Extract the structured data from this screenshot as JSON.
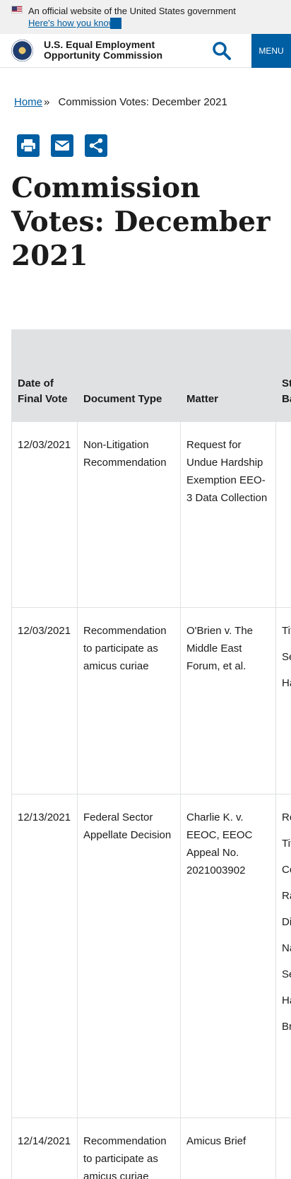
{
  "gov_banner": {
    "text": "An official website of the United States government",
    "link": "Here's how you know"
  },
  "header": {
    "site_name_line1": "U.S. Equal Employment",
    "site_name_line2": "Opportunity Commission",
    "menu_label": "MENU"
  },
  "breadcrumb": {
    "home": "Home",
    "separator": "»",
    "current": "Commission Votes: December 2021"
  },
  "page": {
    "title": "Commission Votes: December 2021"
  },
  "table": {
    "headers": [
      "Date of Final Vote",
      "Document Type",
      "Matter",
      "Statutes/ Issues/ Bases Involved"
    ],
    "rows": [
      {
        "date": "12/03/2021",
        "type": "Non-Litigation Recommendation",
        "matter": "Request for Undue Hardship Exemption EEO-3 Data Collection",
        "issues": []
      },
      {
        "date": "12/03/2021",
        "type": "Recommendation to participate as amicus curiae",
        "matter": "O'Brien v. The Middle East Forum, et al.",
        "issues": [
          "Title VII",
          "Sex",
          "Harassment"
        ]
      },
      {
        "date": "12/13/2021",
        "type": "Federal Sector Appellate Decision",
        "matter": "Charlie K. v. EEOC, EEOC Appeal No. 2021003902",
        "issues": [
          "Rehabilitation Act",
          "Title VII",
          "Color",
          "Race",
          "Disability",
          "National Origin",
          "Sex",
          "Harassment",
          "Breach of Confidentiality"
        ]
      },
      {
        "date": "12/14/2021",
        "type": "Recommendation to participate as amicus curiae",
        "matter": "Amicus Brief",
        "issues": []
      }
    ]
  },
  "colors": {
    "primary": "#005ea2",
    "header_bg": "#dfe1e2",
    "banner_bg": "#f0f0f0"
  },
  "icons": {
    "search": "search-icon",
    "print": "print-icon",
    "email": "email-icon",
    "share": "share-icon"
  }
}
